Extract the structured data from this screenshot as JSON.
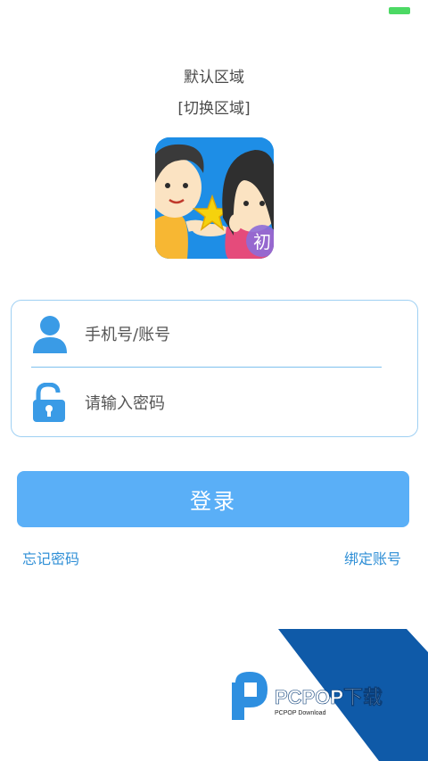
{
  "region": {
    "current_label": "默认区域",
    "switch_label": "[切换区域]"
  },
  "app_logo": {
    "badge_text": "初"
  },
  "form": {
    "account_placeholder": "手机号/账号",
    "password_placeholder": "请输入密码"
  },
  "actions": {
    "login_label": "登录",
    "forgot_password_label": "忘记密码",
    "bind_account_label": "绑定账号"
  },
  "watermark": {
    "brand": "PCPOP下载",
    "sub": "PCPOP Download"
  },
  "colors": {
    "accent": "#5aaff7",
    "link": "#2f8fd6",
    "icon": "#3a9be6",
    "border": "#9fd0f3",
    "watermark_band": "#0f5aa8"
  }
}
